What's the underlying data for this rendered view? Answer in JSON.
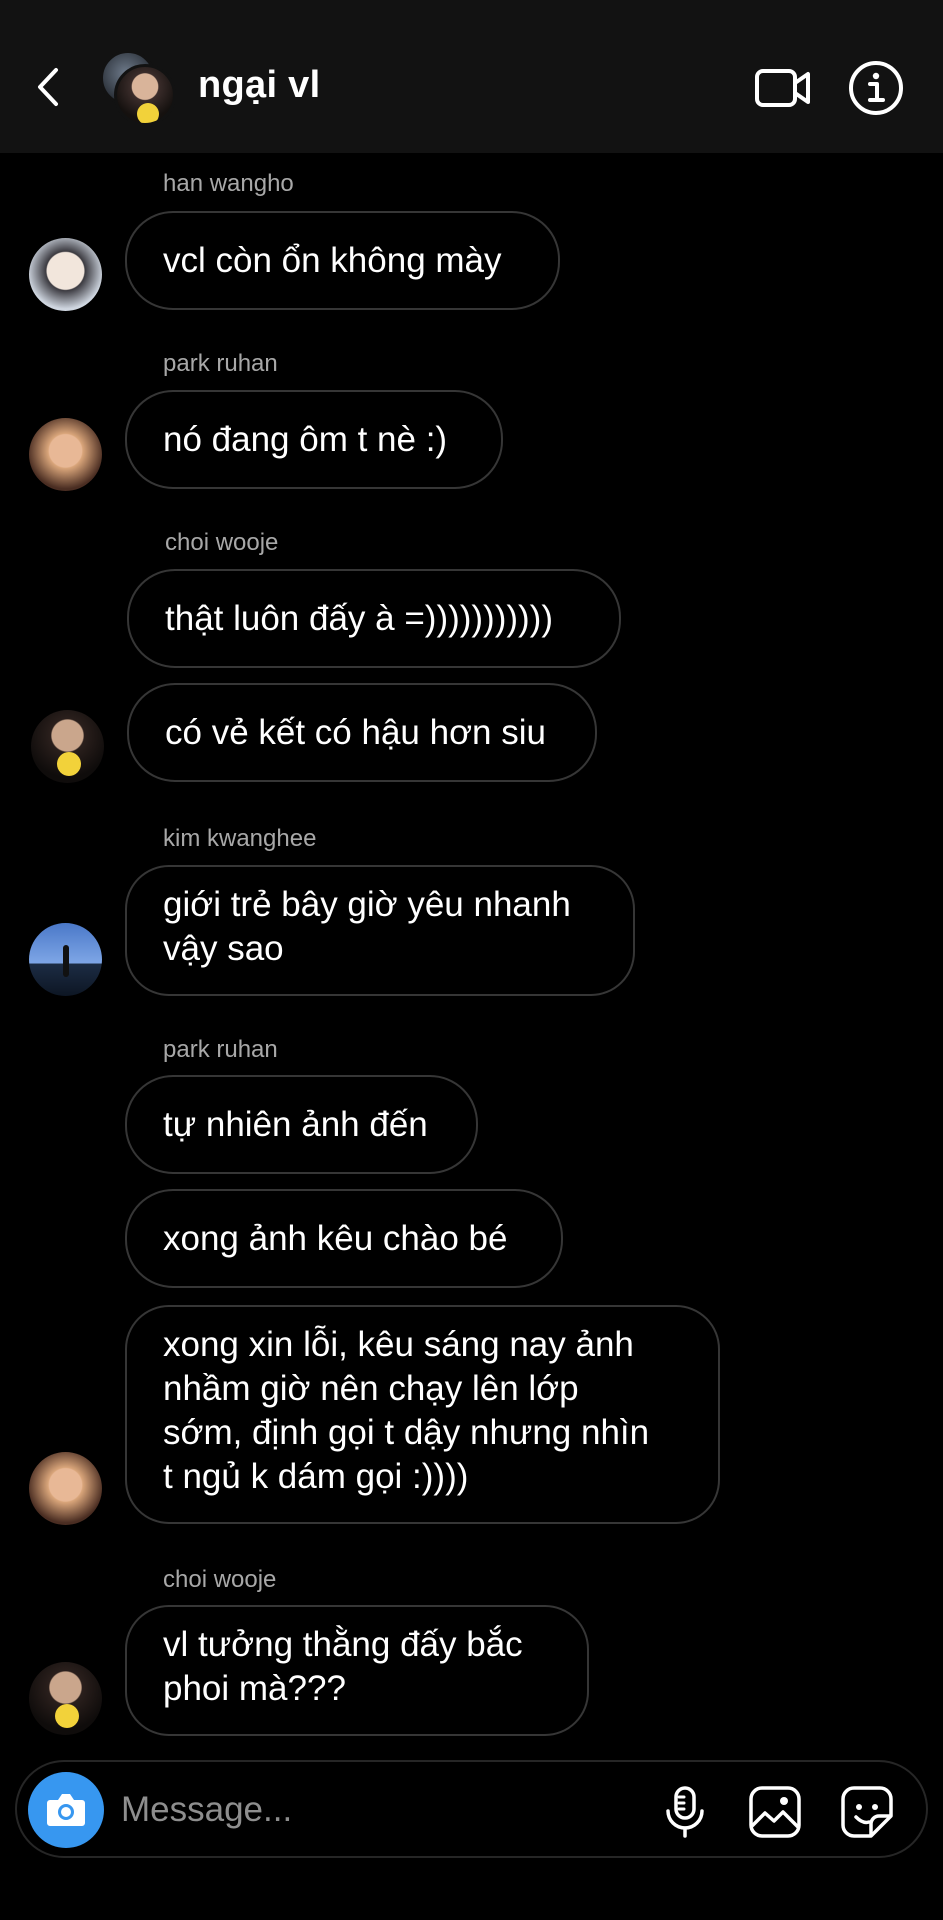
{
  "header": {
    "title": "ngại vl",
    "icons": [
      "back-chevron-icon",
      "video-call-icon",
      "info-icon"
    ]
  },
  "messages": [
    {
      "sender": "han wangho",
      "text": "vcl còn ổn không mày"
    },
    {
      "sender": "park ruhan",
      "text": "nó đang ôm t nè :)"
    },
    {
      "sender": "choi wooje",
      "text": "thật luôn đấy à =)))))))))))"
    },
    {
      "text": "có vẻ kết có hậu hơn siu"
    },
    {
      "sender": "kim kwanghee",
      "text": "giới trẻ bây giờ yêu nhanh\nvậy sao"
    },
    {
      "sender": "park ruhan",
      "text": "tự nhiên ảnh đến"
    },
    {
      "text": "xong ảnh kêu chào bé"
    },
    {
      "text": "xong xin lỗi, kêu sáng nay ảnh\nnhầm giờ nên chạy lên lớp\nsớm, định gọi t dậy nhưng nhìn\nt ngủ k dám gọi :))))"
    },
    {
      "sender": "choi wooje",
      "text": "vl tưởng thằng đấy bắc\nphoi mà???"
    }
  ],
  "composer": {
    "placeholder": "Message...",
    "icons": [
      "camera-icon",
      "microphone-icon",
      "gallery-icon",
      "sticker-icon"
    ],
    "accent": "#3797f0"
  },
  "colors": {
    "background": "#000000",
    "header": "#121212",
    "bubble_border": "#363636",
    "secondary_text": "#a8a8a8"
  }
}
